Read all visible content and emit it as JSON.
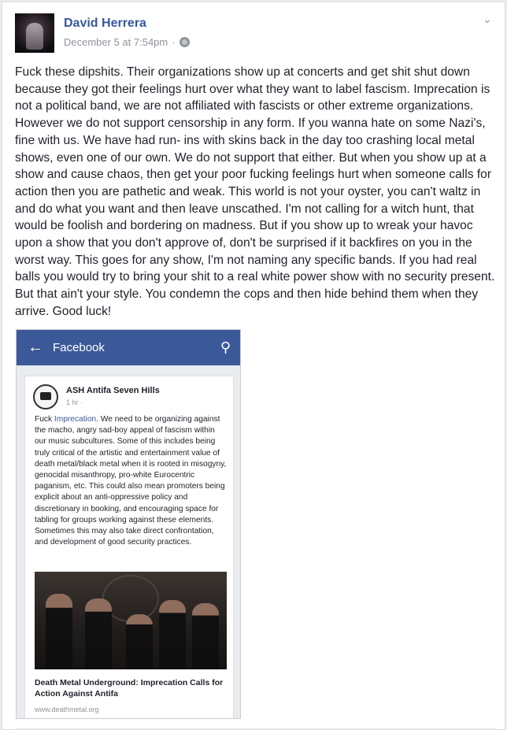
{
  "post": {
    "author": "David Herrera",
    "date": "December 5 at 7:54pm",
    "separator": "·",
    "text": "Fuck these dipshits. Their organizations show up at concerts and get shit shut down because they got their feelings hurt over what they want to label fascism. Imprecation is not a political band, we are not affiliated with fascists or other extreme organizations. However we do not support censorship in any form. If you wanna hate on some Nazi's, fine with us. We have had run- ins with skins back in the day too crashing local metal shows, even one of our own. We do not support that either. But when you show up at a show and cause chaos, then get your poor fucking feelings hurt when someone calls for action then you are pathetic and weak. This world is not your oyster, you can't waltz in and do what you want and then leave unscathed. I'm not calling for a witch hunt, that would be foolish and bordering on madness. But if you show up to wreak your havoc upon a show that you don't approve of, don't be surprised if it backfires on you in the worst way. This goes for any show, I'm not naming any specific bands. If you had real balls you would try to bring your shit to a real white power show with no security present. But that ain't your style. You condemn the cops and then hide behind them when they arrive. Good luck!"
  },
  "icons": {
    "privacy": "globe-icon",
    "options": "chevron-down-icon",
    "back": "back-arrow-icon",
    "search": "search-icon"
  },
  "screenshot": {
    "app_bar_title": "Facebook",
    "card": {
      "page_name": "ASH Antifa Seven Hills",
      "time": "1 hr · ",
      "text_prefix": "Fuck ",
      "mention": "Imprecation",
      "text_rest": ". We need to be organizing against the macho, angry sad-boy appeal of fascism within our music subcultures. Some of this includes being truly critical of the artistic and entertainment value of death metal/black metal when it is rooted in misogyny, genocidal misanthropy, pro-white Eurocentric paganism, etc. This could also mean promoters being explicit about an anti-oppressive policy and discretionary in booking, and encouraging space for tabling for groups working against these elements. Sometimes this may also take direct confrontation, and development of good security practices.",
      "link_title": "Death Metal Underground: Imprecation Calls for Action Against Antifa",
      "link_domain": "www.deathmetal.org"
    }
  },
  "colors": {
    "brand": "#3b5998",
    "link": "#365899",
    "text": "#1d2129",
    "muted": "#90949c"
  }
}
